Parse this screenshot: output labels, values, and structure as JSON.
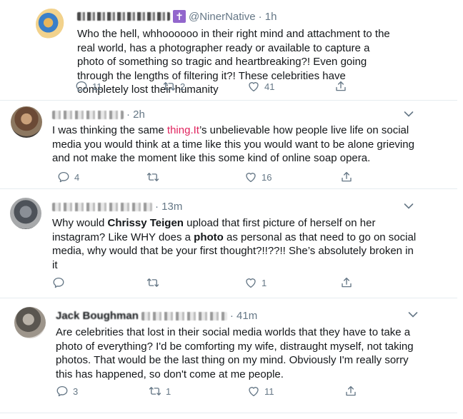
{
  "tweets": [
    {
      "handle": "@NinerNative",
      "time": "· 1h",
      "text": "Who the hell, whhoooooo in their right mind and attachment to the real world, has a photographer ready or available to capture a photo of something so tragic and heartbreaking?! Even going through the lengths of filtering it?! These celebrities have completely lost their humanity",
      "replies": "11",
      "retweets": "2",
      "likes": "41"
    },
    {
      "time": "· 2h",
      "text_before": "I was thinking the same ",
      "text_link": "thing.It",
      "text_after": "’s unbelievable how people live life on social media you would think at a time like this you would want to be alone grieving and not make the moment like this some kind of online soap opera.",
      "replies": "4",
      "retweets": "",
      "likes": "16"
    },
    {
      "time": "· 13m",
      "t1": "Why would ",
      "t2": "Chrissy Teigen",
      "t3": " upload that first picture of herself on her instagram? Like WHY does a ",
      "t4": "photo",
      "t5": " as personal as that need to go on social media, why would that be your first thought?!!??!! She’s absolutely broken in it",
      "replies": "",
      "retweets": "",
      "likes": "1"
    },
    {
      "name": "Jack Boughman",
      "time": "· 41m",
      "text": "Are celebrities that lost in their social media worlds that they have to take a photo of everything? I'd be comforting my wife, distraught myself, not taking photos. That would be the last thing on my mind. Obviously I'm really sorry this has happened, so don't come at me people.",
      "replies": "3",
      "retweets": "1",
      "likes": "11"
    }
  ],
  "icons": [
    "reply-icon",
    "retweet-icon",
    "like-icon",
    "share-icon",
    "chevron-down-icon",
    "cross-icon"
  ],
  "colors": {
    "text": "#14171a",
    "muted": "#657786",
    "link": "#e0245e",
    "badge": "#9266cc"
  }
}
